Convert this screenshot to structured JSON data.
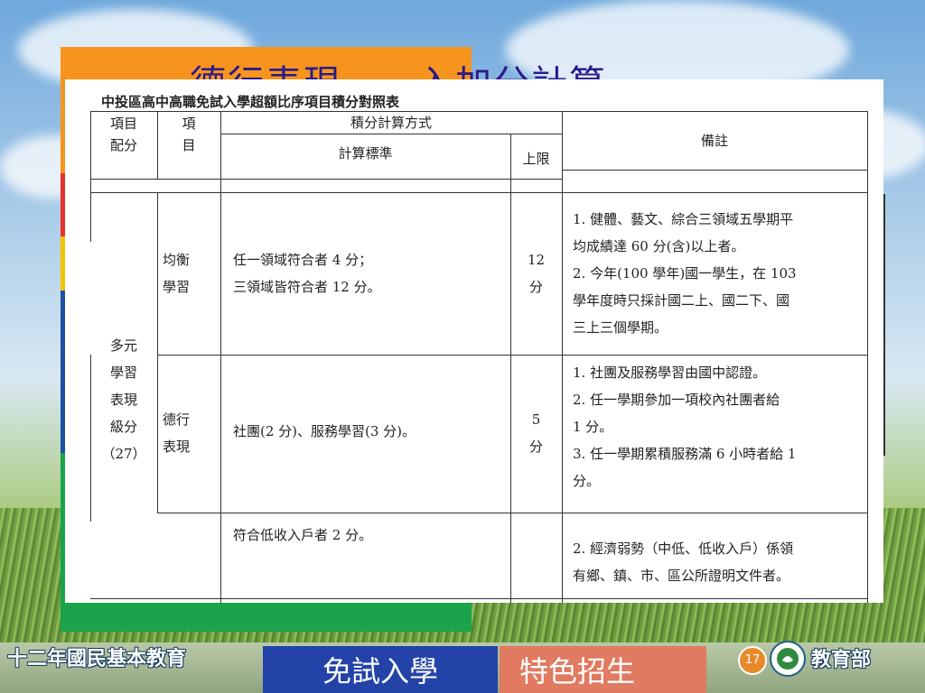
{
  "slide": {
    "title_fragment": "德行表現　　入加分計算",
    "page_number": "17"
  },
  "document": {
    "title": "中投區高中高職免試入學超額比序項目積分對照表",
    "headers": {
      "item_score_1": "項目",
      "item_score_2": "配分",
      "item_1": "項",
      "item_2": "目",
      "method": "積分計算方式",
      "standard": "計算標準",
      "limit": "上限",
      "notes": "備註"
    },
    "rows": {
      "category": [
        "多元",
        "學習",
        "表現",
        "級分",
        "（27）"
      ],
      "balanced": {
        "item": [
          "均衡",
          "學習"
        ],
        "standard": [
          "任一領域符合者 4 分；",
          "三領域皆符合者 12 分。"
        ],
        "limit": [
          "12",
          "分"
        ],
        "notes": [
          "1. 健體、藝文、綜合三領域五學期平",
          "均成績達 60 分(含)以上者。",
          "2. 今年(100 學年)國一學生，在 103",
          "學年度時只採計國二上、國二下、國",
          "三上三個學期。"
        ]
      },
      "conduct": {
        "item": [
          "德行",
          "表現"
        ],
        "standard": [
          "社團(2 分)、服務學習(3 分)。"
        ],
        "limit": [
          "5",
          "分"
        ],
        "notes": [
          "1. 社團及服務學習由國中認證。",
          "2. 任一學期參加一項校內社團者給",
          "1 分。",
          "3. 任一學期累積服務滿 6 小時者給 1",
          "分。"
        ]
      },
      "low_income": {
        "standard": "符合低收入戶者 2 分。",
        "notes": [
          "2. 經濟弱勢（中低、低收入戶）係領",
          "有鄉、鎮、市、區公所證明文件者。"
        ]
      }
    }
  },
  "footer": {
    "left_text": "十二年國民基本教育",
    "tab_exam_free": "免試入學",
    "tab_special": "特色招生",
    "ministry": "教育部"
  },
  "colors": {
    "orange": "#f7941d",
    "red": "#e8312a",
    "blue": "#1f4fa3",
    "yellow": "#f2c400",
    "green": "#1aa34a",
    "tab_blue": "#2343a8",
    "tab_coral": "#e07a60"
  }
}
